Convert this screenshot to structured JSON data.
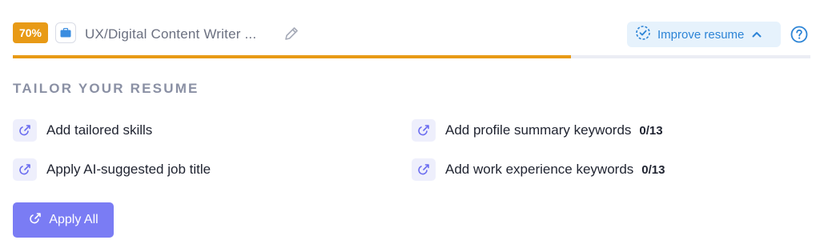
{
  "header": {
    "score_badge": "70%",
    "job_icon": "briefcase-icon",
    "job_title": "UX/Digital Content Writer ...",
    "edit_icon": "pencil-icon",
    "improve_label": "Improve resume",
    "improve_icon": "dashed-check-circle-icon",
    "improve_chevron": "chevron-up-icon",
    "help_icon": "question-circle-icon"
  },
  "progress": {
    "value_percent": 70
  },
  "section": {
    "title": "TAILOR YOUR RESUME"
  },
  "actions": [
    {
      "label": "Add tailored skills",
      "count": "",
      "icon": "tailor-magic-icon"
    },
    {
      "label": "Add profile summary keywords",
      "count": "0/13",
      "icon": "tailor-magic-icon"
    },
    {
      "label": "Apply AI-suggested job title",
      "count": "",
      "icon": "tailor-magic-icon"
    },
    {
      "label": "Add work experience keywords",
      "count": "0/13",
      "icon": "tailor-magic-icon"
    }
  ],
  "apply_all": {
    "label": "Apply All",
    "icon": "tailor-magic-icon"
  },
  "colors": {
    "accent_orange": "#e89a16",
    "accent_purple": "#7a7cf4",
    "link_blue": "#2c84d6"
  }
}
